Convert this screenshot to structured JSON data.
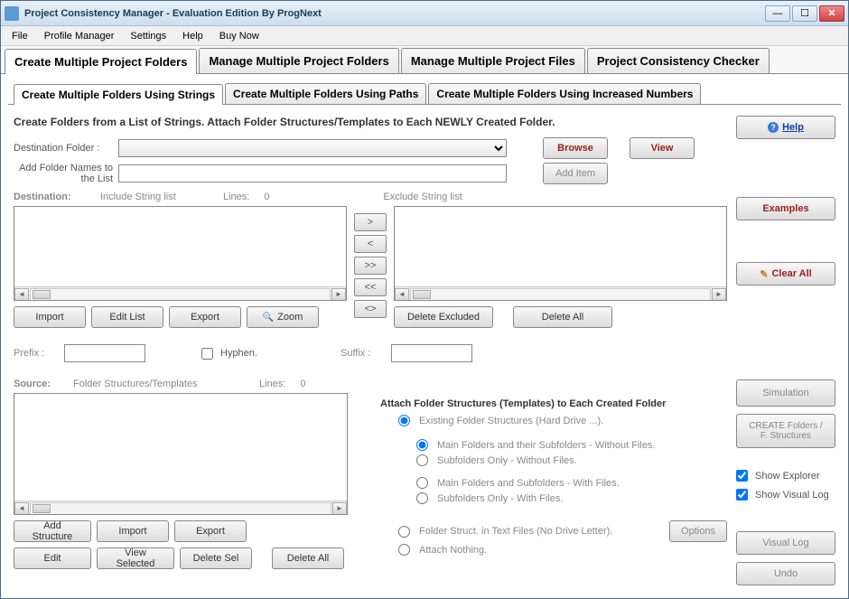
{
  "window": {
    "title": "Project Consistency Manager - Evaluation Edition  By ProgNext"
  },
  "menubar": [
    "File",
    "Profile Manager",
    "Settings",
    "Help",
    "Buy Now"
  ],
  "main_tabs": [
    "Create Multiple Project Folders",
    "Manage Multiple Project Folders",
    "Manage Multiple Project Files",
    "Project Consistency Checker"
  ],
  "sub_tabs": [
    "Create Multiple Folders Using Strings",
    "Create Multiple Folders Using Paths",
    "Create Multiple Folders Using Increased Numbers"
  ],
  "description": "Create Folders from a List of Strings. Attach Folder Structures/Templates to Each NEWLY Created Folder.",
  "labels": {
    "dest_folder": "Destination Folder :",
    "add_names": "Add Folder Names to the List",
    "destination": "Destination:",
    "include": "Include String list",
    "lines": "Lines:",
    "lines_count1": "0",
    "exclude": "Exclude String list",
    "prefix": "Prefix :",
    "hyphen": "Hyphen.",
    "suffix": "Suffix :",
    "source": "Source:",
    "fst": "Folder Structures/Templates",
    "lines_count2": "0",
    "attach_title": "Attach Folder Structures (Templates) to Each Created Folder"
  },
  "buttons": {
    "browse": "Browse",
    "view": "View",
    "add_item": "Add Item",
    "help": "Help",
    "examples": "Examples",
    "clear_all": "Clear All",
    "import": "Import",
    "edit_list": "Edit List",
    "export": "Export",
    "zoom": "Zoom",
    "delete_excluded": "Delete Excluded",
    "delete_all": "Delete All",
    "add_structure": "Add Structure",
    "edit": "Edit",
    "view_selected": "View Selected",
    "delete_sel": "Delete Sel",
    "options": "Options",
    "simulation": "Simulation",
    "create": "CREATE Folders / F. Structures",
    "visual_log": "Visual Log",
    "undo": "Undo"
  },
  "arrows": {
    "right": ">",
    "left": "<",
    "rr": ">>",
    "ll": "<<",
    "swap": "<>"
  },
  "radios": {
    "existing": "Existing Folder Structures (Hard Drive ...).",
    "main_sub_no_files": "Main Folders and their Subfolders - Without Files.",
    "sub_no_files": "Subfolders Only - Without Files.",
    "main_sub_files": "Main Folders and Subfolders - With Files.",
    "sub_files": "Subfolders Only - With Files.",
    "textfiles": "Folder Struct. in Text Files (No Drive Letter).",
    "nothing": "Attach Nothing."
  },
  "checkboxes": {
    "show_explorer": "Show Explorer",
    "show_visual_log": "Show Visual Log"
  }
}
